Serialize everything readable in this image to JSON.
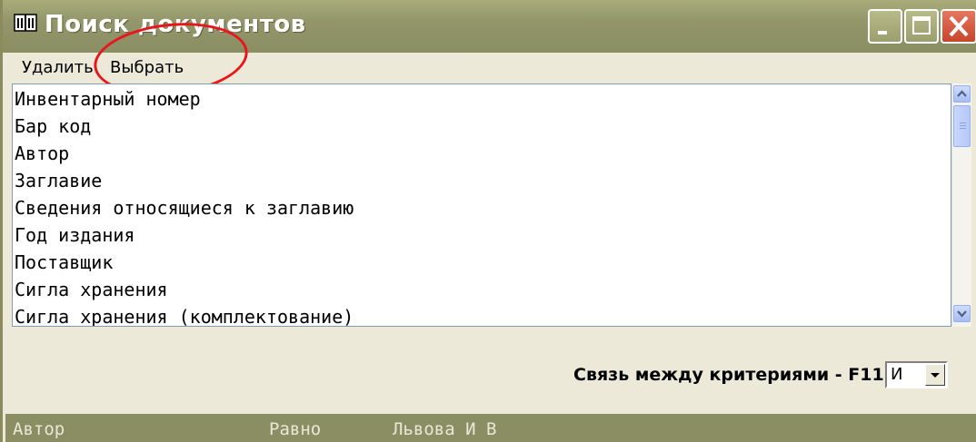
{
  "window": {
    "title": "Поиск документов",
    "titlebar_color": "#8b8e62",
    "close_button_color": "#d6563a"
  },
  "menu": {
    "delete_label": "Удалить",
    "select_label": "Выбрать"
  },
  "annotation": {
    "shape": "ellipse",
    "color": "#e8161c",
    "highlights": "Выбрать"
  },
  "list": {
    "items": [
      "Инвентарный номер",
      "Бар код",
      "Автор",
      "Заглавие",
      "Сведения относящиеся к заглавию",
      "Год издания",
      "Поставщик",
      "Сигла хранения",
      "Сигла хранения (комплектование)"
    ]
  },
  "criteria_link": {
    "label": "Связь между критериями - F11",
    "selected": "И"
  },
  "status": {
    "field": "Автор",
    "operator": "Равно",
    "value": "Львова И В"
  },
  "icons": [
    "book-icon",
    "minimize-icon",
    "maximize-icon",
    "close-icon",
    "scroll-up-icon",
    "scroll-down-icon",
    "dropdown-arrow-icon"
  ]
}
